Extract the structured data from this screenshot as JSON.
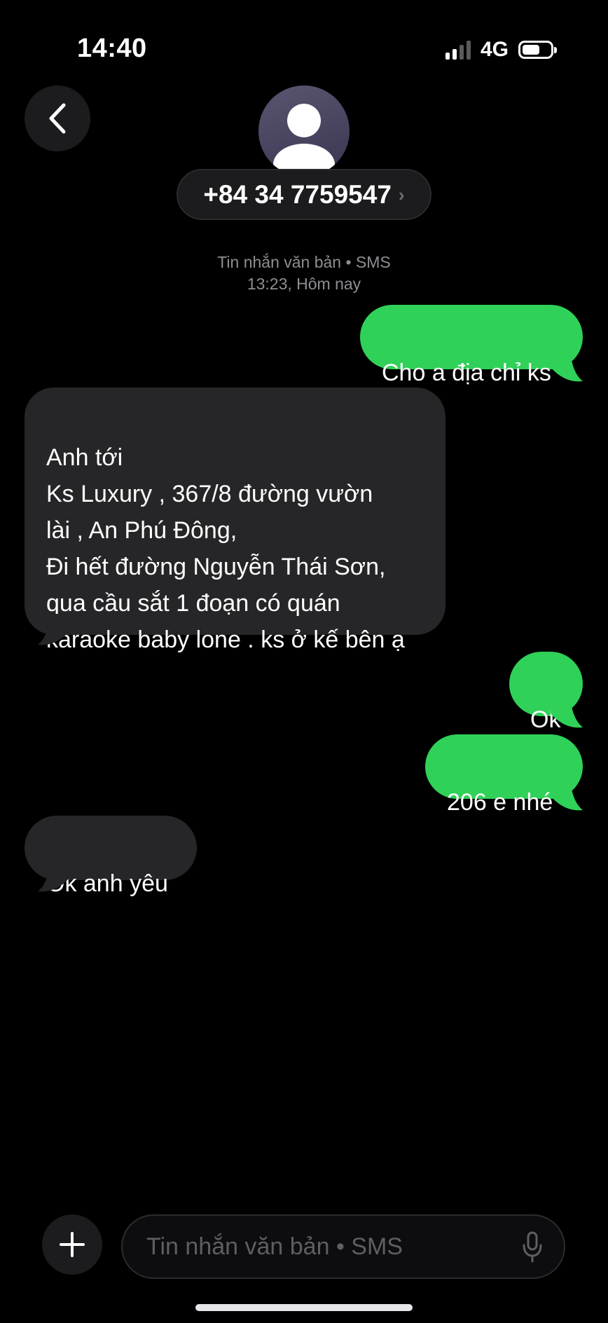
{
  "status_bar": {
    "time": "14:40",
    "network": "4G",
    "icons": [
      "signal-bars-icon",
      "battery-icon"
    ]
  },
  "header": {
    "back_icon": "chevron-left-icon",
    "avatar_icon": "person-silhouette-icon",
    "contact_number": "+84 34 7759547",
    "contact_chevron": "›"
  },
  "thread_meta": {
    "type_line": "Tin nhắn văn bản • SMS",
    "time_line": "13:23, Hôm nay"
  },
  "messages": [
    {
      "direction": "outgoing",
      "text": "Cho a địa chỉ ks"
    },
    {
      "direction": "incoming",
      "text": "Anh tới\nKs Luxury , 367/8 đường vườn\nlài , An Phú Đông,\nĐi hết đường Nguyễn Thái Sơn,\nqua cầu sắt 1 đoạn có quán\nkaraoke baby lone . ks ở kế bên ạ"
    },
    {
      "direction": "outgoing",
      "text": "Ok"
    },
    {
      "direction": "outgoing",
      "text": "206 e nhé"
    },
    {
      "direction": "incoming",
      "text": "Ok anh yêu"
    }
  ],
  "composer": {
    "add_icon": "plus-icon",
    "placeholder": "Tin nhắn văn bản • SMS",
    "mic_icon": "microphone-icon"
  },
  "colors": {
    "background": "#000000",
    "outgoing_bubble": "#30d158",
    "incoming_bubble": "#262628",
    "meta_text": "#8e8e93"
  }
}
